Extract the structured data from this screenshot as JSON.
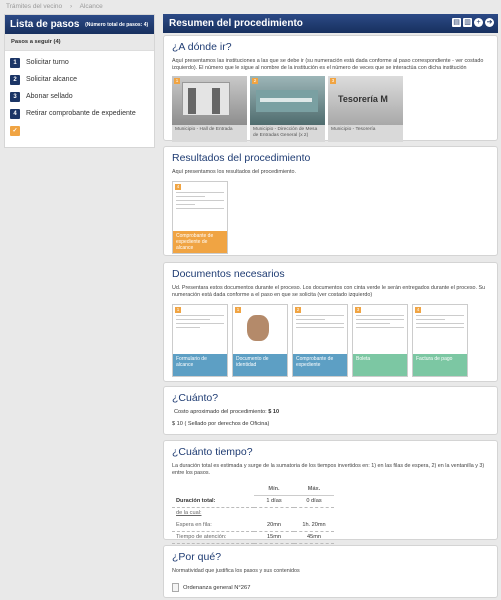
{
  "breadcrumb": [
    "Trámites del vecino",
    "›",
    "Alcance"
  ],
  "sidebar": {
    "title": "Lista de pasos",
    "subtitle": "(Número total de pasos: 4)",
    "steps_head": "Pasos a seguir (4)",
    "steps": [
      {
        "n": "1",
        "label": "Solicitar turno"
      },
      {
        "n": "2",
        "label": "Solicitar alcance"
      },
      {
        "n": "3",
        "label": "Abonar sellado"
      },
      {
        "n": "4",
        "label": "Retirar comprobante de expediente"
      }
    ],
    "check": "✓"
  },
  "main": {
    "title": "Resumen del procedimiento",
    "tools": [
      "print-icon",
      "document-icon",
      "plus-icon",
      "arrow-right-icon"
    ]
  },
  "donde": {
    "title": "¿A dónde ir?",
    "text": "Aquí presentamos las instituciones a las que se debe ir (su numeración está dada conforme al paso correspondiente - ver costado izquierdo). El número que le sigue al nombre de la institución es el número de veces que se interactúa con dicha institución",
    "places": [
      {
        "n": "1",
        "caption": "Municipio - Hall de Entrada"
      },
      {
        "n": "2",
        "caption": "Municipio - Dirección de Mesa de Entradas General (x 2)"
      },
      {
        "n": "3",
        "caption": "Municipio - Tesorería"
      }
    ],
    "sign_text": "Tesorería M"
  },
  "resultados": {
    "title": "Resultados del procedimiento",
    "text": "Aquí presentamos los resultados del procedimiento.",
    "doc": {
      "n": "4",
      "caption": "Comprobante de expediente de alcance",
      "color": "#f0a443"
    }
  },
  "documentos": {
    "title": "Documentos necesarios",
    "text": "Ud. Presentara estos documentos durante el proceso. Los documentos con cinta verde le serán entregados durante el proceso. Su numeración está dada conforme a el paso en que se solicita (ver costado izquierdo)",
    "docs": [
      {
        "n": "1",
        "caption": "Formulario de alcance",
        "color": "#5d9fc4"
      },
      {
        "n": "1",
        "caption": "Documento de identidad",
        "color": "#5d9fc4"
      },
      {
        "n": "2",
        "caption": "Comprobante de expediente",
        "color": "#5d9fc4"
      },
      {
        "n": "3",
        "caption": "Boleta",
        "color": "#7cc7a3"
      },
      {
        "n": "4",
        "caption": "Factura de pago",
        "color": "#7cc7a3"
      }
    ]
  },
  "cuanto": {
    "title": "¿Cuánto?",
    "line1_label": "Costo aproximado del procedimiento:",
    "line1_value": "$ 10",
    "line2": "$ 10 ( Sellado por derechos de Oficina)"
  },
  "tiempo": {
    "title": "¿Cuánto tiempo?",
    "text": "La duración total es estimada y surge de la sumatoria de los tiempos invertidos en: 1) en las filas de espera, 2) en la ventanilla y 3) entre los pasos.",
    "col_min": "Mín.",
    "col_max": "Máx.",
    "rows": [
      {
        "label": "Duración total:",
        "min": "1 días",
        "max": "0 días"
      },
      {
        "label": "de la cual:",
        "min": "",
        "max": ""
      },
      {
        "label": "Espera en fila:",
        "min": "20mn",
        "max": "1h. 20mn"
      },
      {
        "label": "Tiempo de atención:",
        "min": "15mn",
        "max": "45mn"
      }
    ]
  },
  "porque": {
    "title": "¿Por qué?",
    "text": "Normatividad que justifica los pasos y sus contenidos",
    "ordinance": "Ordenanza general N°267"
  }
}
